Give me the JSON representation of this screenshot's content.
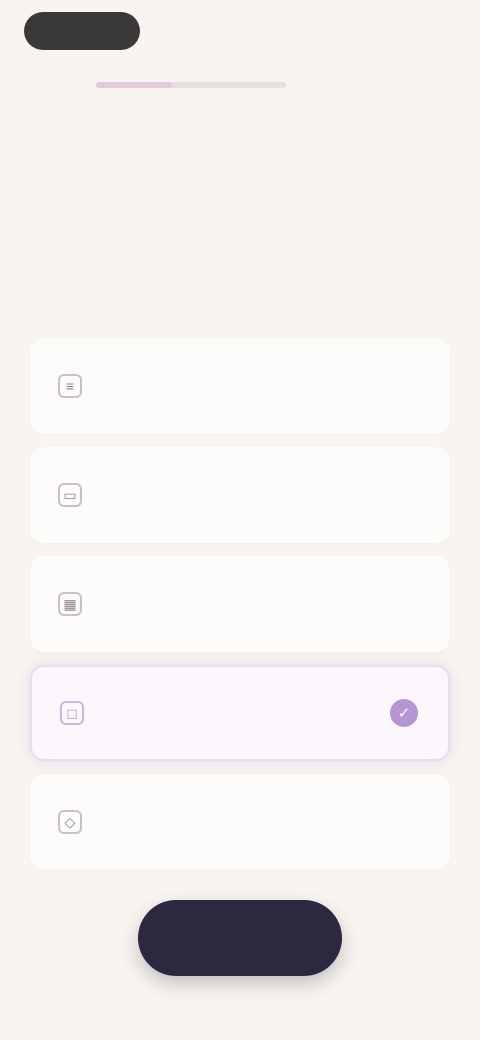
{
  "header": {
    "back_label": "",
    "right_label": ""
  },
  "progress": {
    "value": 0.4
  },
  "question": {
    "title": ""
  },
  "options": [
    {
      "icon": "list-icon",
      "glyph": "≡",
      "label": "",
      "selected": false
    },
    {
      "icon": "book-icon",
      "glyph": "▭",
      "label": "",
      "selected": false
    },
    {
      "icon": "grid-icon",
      "glyph": "▦",
      "label": "",
      "selected": false
    },
    {
      "icon": "chat-icon",
      "glyph": "◻",
      "label": "",
      "selected": true
    },
    {
      "icon": "tag-icon",
      "glyph": "◇",
      "label": "",
      "selected": false
    }
  ],
  "cta": {
    "label": ""
  },
  "colors": {
    "background": "#f8f4ef",
    "accent": "#b795d4",
    "cta": "#2b2840"
  }
}
